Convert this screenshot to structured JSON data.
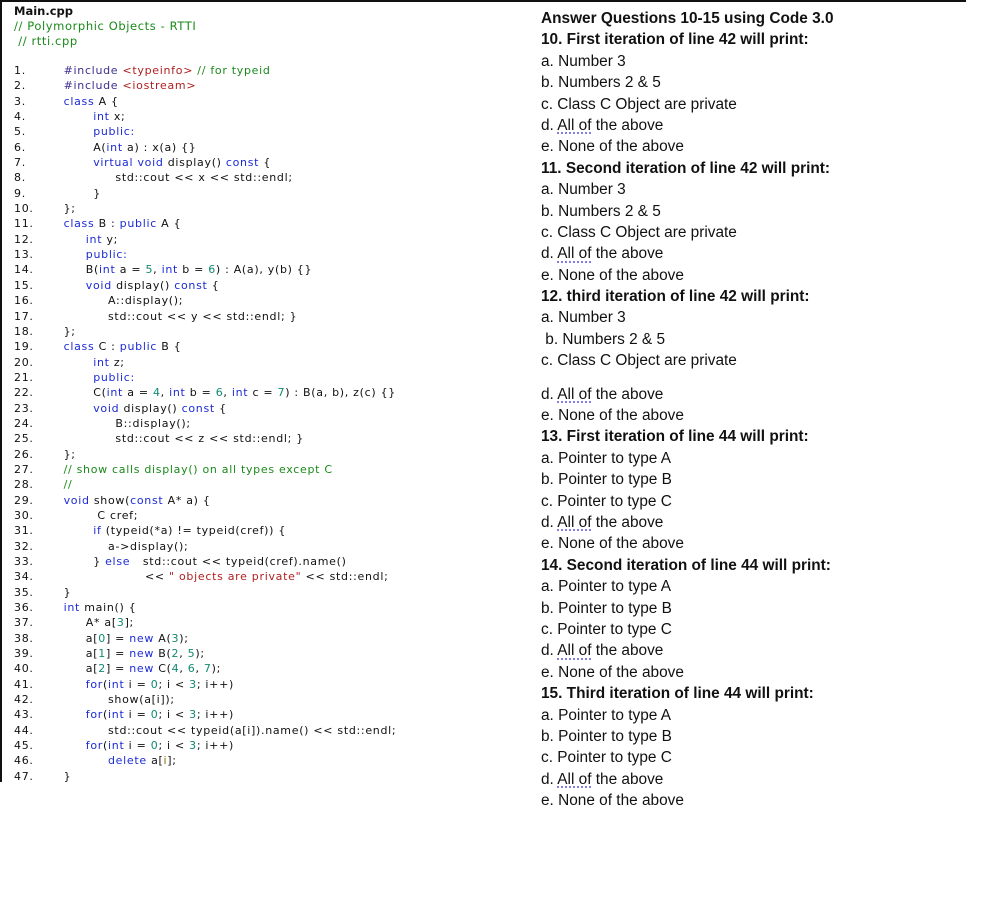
{
  "code_panel": {
    "file_title": "Main.cpp",
    "header_comments": [
      "// Polymorphic Objects - RTTI",
      " // rtti.cpp"
    ],
    "lines": [
      {
        "n": "1.",
        "indent": 4,
        "tokens": [
          [
            "pre",
            "#include "
          ],
          [
            "str",
            "<typeinfo>"
          ],
          [
            "com",
            " // for typeid"
          ]
        ]
      },
      {
        "n": "2.",
        "indent": 4,
        "tokens": [
          [
            "pre",
            "#include "
          ],
          [
            "str",
            "<iostream>"
          ]
        ]
      },
      {
        "n": "3.",
        "indent": 4,
        "tokens": [
          [
            "kw",
            "class "
          ],
          [
            "txt",
            "A {"
          ]
        ]
      },
      {
        "n": "4.",
        "indent": 8,
        "tokens": [
          [
            "kw",
            "int "
          ],
          [
            "txt",
            "x;"
          ]
        ]
      },
      {
        "n": "5.",
        "indent": 8,
        "tokens": [
          [
            "kw",
            "public:"
          ]
        ]
      },
      {
        "n": "6.",
        "indent": 8,
        "tokens": [
          [
            "txt",
            "A("
          ],
          [
            "kw",
            "int "
          ],
          [
            "txt",
            "a) : x(a) {}"
          ]
        ]
      },
      {
        "n": "7.",
        "indent": 8,
        "tokens": [
          [
            "kw",
            "virtual void "
          ],
          [
            "txt",
            "display() "
          ],
          [
            "kw",
            "const "
          ],
          [
            "txt",
            "{"
          ]
        ]
      },
      {
        "n": "8.",
        "indent": 11,
        "tokens": [
          [
            "txt",
            "std::cout << x << std::endl;"
          ]
        ]
      },
      {
        "n": "9.",
        "indent": 8,
        "tokens": [
          [
            "txt",
            "}"
          ]
        ]
      },
      {
        "n": "10.",
        "indent": 4,
        "tokens": [
          [
            "txt",
            "};"
          ]
        ]
      },
      {
        "n": "11.",
        "indent": 4,
        "tokens": [
          [
            "kw",
            "class "
          ],
          [
            "txt",
            "B : "
          ],
          [
            "kw",
            "public "
          ],
          [
            "txt",
            "A {"
          ]
        ]
      },
      {
        "n": "12.",
        "indent": 7,
        "tokens": [
          [
            "kw",
            "int "
          ],
          [
            "txt",
            "y;"
          ]
        ]
      },
      {
        "n": "13.",
        "indent": 7,
        "tokens": [
          [
            "kw",
            "public:"
          ]
        ]
      },
      {
        "n": "14.",
        "indent": 7,
        "tokens": [
          [
            "txt",
            "B("
          ],
          [
            "kw",
            "int "
          ],
          [
            "txt",
            "a = "
          ],
          [
            "num",
            "5"
          ],
          [
            "txt",
            ", "
          ],
          [
            "kw",
            "int "
          ],
          [
            "txt",
            "b = "
          ],
          [
            "num",
            "6"
          ],
          [
            "txt",
            ") : A(a), y(b) {}"
          ]
        ]
      },
      {
        "n": "15.",
        "indent": 7,
        "tokens": [
          [
            "kw",
            "void "
          ],
          [
            "txt",
            "display() "
          ],
          [
            "kw",
            "const "
          ],
          [
            "txt",
            "{"
          ]
        ]
      },
      {
        "n": "16.",
        "indent": 10,
        "tokens": [
          [
            "txt",
            "A::display();"
          ]
        ]
      },
      {
        "n": "17.",
        "indent": 10,
        "tokens": [
          [
            "txt",
            "std::cout << y << std::endl; }"
          ]
        ]
      },
      {
        "n": "18.",
        "indent": 4,
        "tokens": [
          [
            "txt",
            "};"
          ]
        ]
      },
      {
        "n": "19.",
        "indent": 4,
        "tokens": [
          [
            "kw",
            "class "
          ],
          [
            "txt",
            "C : "
          ],
          [
            "kw",
            "public "
          ],
          [
            "txt",
            "B {"
          ]
        ]
      },
      {
        "n": "20.",
        "indent": 8,
        "tokens": [
          [
            "kw",
            "int "
          ],
          [
            "txt",
            "z;"
          ]
        ]
      },
      {
        "n": "21.",
        "indent": 8,
        "tokens": [
          [
            "kw",
            "public:"
          ]
        ]
      },
      {
        "n": "22.",
        "indent": 8,
        "tokens": [
          [
            "txt",
            "C("
          ],
          [
            "kw",
            "int "
          ],
          [
            "txt",
            "a = "
          ],
          [
            "num",
            "4"
          ],
          [
            "txt",
            ", "
          ],
          [
            "kw",
            "int "
          ],
          [
            "txt",
            "b = "
          ],
          [
            "num",
            "6"
          ],
          [
            "txt",
            ", "
          ],
          [
            "kw",
            "int "
          ],
          [
            "txt",
            "c = "
          ],
          [
            "num",
            "7"
          ],
          [
            "txt",
            ") : B(a, b), z(c) {}"
          ]
        ]
      },
      {
        "n": "23.",
        "indent": 8,
        "tokens": [
          [
            "kw",
            "void "
          ],
          [
            "txt",
            "display() "
          ],
          [
            "kw",
            "const "
          ],
          [
            "txt",
            "{"
          ]
        ]
      },
      {
        "n": "24.",
        "indent": 11,
        "tokens": [
          [
            "txt",
            "B::display();"
          ]
        ]
      },
      {
        "n": "25.",
        "indent": 11,
        "tokens": [
          [
            "txt",
            "std::cout << z << std::endl; }"
          ]
        ]
      },
      {
        "n": "26.",
        "indent": 4,
        "tokens": [
          [
            "txt",
            "};"
          ]
        ]
      },
      {
        "n": "27.",
        "indent": 4,
        "tokens": [
          [
            "com",
            "// show calls display() on all types except C"
          ]
        ]
      },
      {
        "n": "28.",
        "indent": 4,
        "tokens": [
          [
            "com",
            "//"
          ]
        ]
      },
      {
        "n": "29.",
        "indent": 4,
        "tokens": [
          [
            "kw",
            "void "
          ],
          [
            "txt",
            "show("
          ],
          [
            "kw",
            "const "
          ],
          [
            "txt",
            "A* a) {"
          ]
        ]
      },
      {
        "n": "30.",
        "indent": 8,
        "tokens": [
          [
            "txt",
            " C cref;"
          ]
        ]
      },
      {
        "n": "31.",
        "indent": 8,
        "tokens": [
          [
            "kw",
            "if "
          ],
          [
            "txt",
            "(typeid(*a) != typeid(cref)) {"
          ]
        ]
      },
      {
        "n": "32.",
        "indent": 10,
        "tokens": [
          [
            "txt",
            "a->display();"
          ]
        ]
      },
      {
        "n": "33.",
        "indent": 8,
        "tokens": [
          [
            "txt",
            "} "
          ],
          [
            "kw",
            "else "
          ],
          [
            "txt",
            "  std::cout << typeid(cref).name()"
          ]
        ]
      },
      {
        "n": "34.",
        "indent": 15,
        "tokens": [
          [
            "txt",
            "<< "
          ],
          [
            "str",
            "\" objects are private\""
          ],
          [
            "txt",
            " << std::endl;"
          ]
        ]
      },
      {
        "n": "35.",
        "indent": 4,
        "tokens": [
          [
            "txt",
            "}"
          ]
        ]
      },
      {
        "n": "36.",
        "indent": 4,
        "tokens": [
          [
            "kw",
            "int "
          ],
          [
            "txt",
            "main() {"
          ]
        ]
      },
      {
        "n": "37.",
        "indent": 7,
        "tokens": [
          [
            "txt",
            "A* a["
          ],
          [
            "num",
            "3"
          ],
          [
            "txt",
            "];"
          ]
        ]
      },
      {
        "n": "38.",
        "indent": 7,
        "tokens": [
          [
            "txt",
            "a["
          ],
          [
            "num",
            "0"
          ],
          [
            "txt",
            "] = "
          ],
          [
            "kw",
            "new "
          ],
          [
            "txt",
            "A("
          ],
          [
            "num",
            "3"
          ],
          [
            "txt",
            ");"
          ]
        ]
      },
      {
        "n": "39.",
        "indent": 7,
        "tokens": [
          [
            "txt",
            "a["
          ],
          [
            "num",
            "1"
          ],
          [
            "txt",
            "] = "
          ],
          [
            "kw",
            "new "
          ],
          [
            "txt",
            "B("
          ],
          [
            "num",
            "2"
          ],
          [
            "txt",
            ", "
          ],
          [
            "num",
            "5"
          ],
          [
            "txt",
            ");"
          ]
        ]
      },
      {
        "n": "40.",
        "indent": 7,
        "tokens": [
          [
            "txt",
            "a["
          ],
          [
            "num",
            "2"
          ],
          [
            "txt",
            "] = "
          ],
          [
            "kw",
            "new "
          ],
          [
            "txt",
            "C("
          ],
          [
            "num",
            "4"
          ],
          [
            "txt",
            ", "
          ],
          [
            "num",
            "6"
          ],
          [
            "txt",
            ", "
          ],
          [
            "num",
            "7"
          ],
          [
            "txt",
            ");"
          ]
        ]
      },
      {
        "n": "41.",
        "indent": 7,
        "tokens": [
          [
            "kw",
            "for"
          ],
          [
            "txt",
            "("
          ],
          [
            "kw",
            "int "
          ],
          [
            "txt",
            "i = "
          ],
          [
            "num",
            "0"
          ],
          [
            "txt",
            "; i < "
          ],
          [
            "num",
            "3"
          ],
          [
            "txt",
            "; i++)"
          ]
        ]
      },
      {
        "n": "42.",
        "indent": 10,
        "tokens": [
          [
            "txt",
            "show(a[i]);"
          ]
        ]
      },
      {
        "n": "43.",
        "indent": 7,
        "tokens": [
          [
            "kw",
            "for"
          ],
          [
            "txt",
            "("
          ],
          [
            "kw",
            "int "
          ],
          [
            "txt",
            "i = "
          ],
          [
            "num",
            "0"
          ],
          [
            "txt",
            "; i < "
          ],
          [
            "num",
            "3"
          ],
          [
            "txt",
            "; i++)"
          ]
        ]
      },
      {
        "n": "44.",
        "indent": 10,
        "tokens": [
          [
            "txt",
            "std::cout << typeid(a[i]).name() << std::endl;"
          ]
        ]
      },
      {
        "n": "45.",
        "indent": 7,
        "tokens": [
          [
            "kw",
            "for"
          ],
          [
            "txt",
            "("
          ],
          [
            "kw",
            "int "
          ],
          [
            "txt",
            "i = "
          ],
          [
            "num",
            "0"
          ],
          [
            "txt",
            "; i < "
          ],
          [
            "num",
            "3"
          ],
          [
            "txt",
            "; i++)"
          ]
        ]
      },
      {
        "n": "46.",
        "indent": 10,
        "tokens": [
          [
            "kw",
            "delete "
          ],
          [
            "txt",
            "a["
          ],
          [
            "idx",
            "i"
          ],
          [
            "txt",
            "];"
          ]
        ]
      },
      {
        "n": "47.",
        "indent": 4,
        "tokens": [
          [
            "txt",
            "}"
          ]
        ]
      }
    ]
  },
  "quiz": {
    "intro": "Answer Questions 10-15 using Code 3.0",
    "questions": [
      {
        "prompt": "10. First iteration of line 42 will print:",
        "options": [
          "a. Number 3",
          "b. Numbers 2 & 5",
          "c. Class C Object are private",
          "d. All of the above",
          "e. None of the above"
        ]
      },
      {
        "prompt": "11. Second iteration of line 42 will print:",
        "options": [
          "a. Number 3",
          "b. Numbers 2 & 5",
          "c. Class C Object are private",
          "d. All of the above",
          "e. None of the above"
        ]
      },
      {
        "prompt": "12. third iteration of line 42 will print:",
        "options": [
          "a. Number 3",
          " b. Numbers 2 & 5",
          "c. Class C Object are private",
          "d. All of the above",
          "e. None of the above"
        ]
      },
      {
        "prompt": "13. First iteration of line 44 will print:",
        "options": [
          "a. Pointer to type A",
          "b. Pointer to type B",
          "c. Pointer to type C",
          "d. All of the above",
          "e. None of the above"
        ]
      },
      {
        "prompt": "14. Second iteration of line 44 will print:",
        "options": [
          "a. Pointer to type A",
          "b. Pointer to type B",
          "c. Pointer to type C",
          "d. All of the above",
          "e. None of the above"
        ]
      },
      {
        "prompt": "15. Third iteration of line 44 will print:",
        "options": [
          "a. Pointer to type A",
          "b. Pointer to type B",
          "c. Pointer to type C",
          "d. All of the above",
          "e. None of the above"
        ]
      }
    ]
  }
}
